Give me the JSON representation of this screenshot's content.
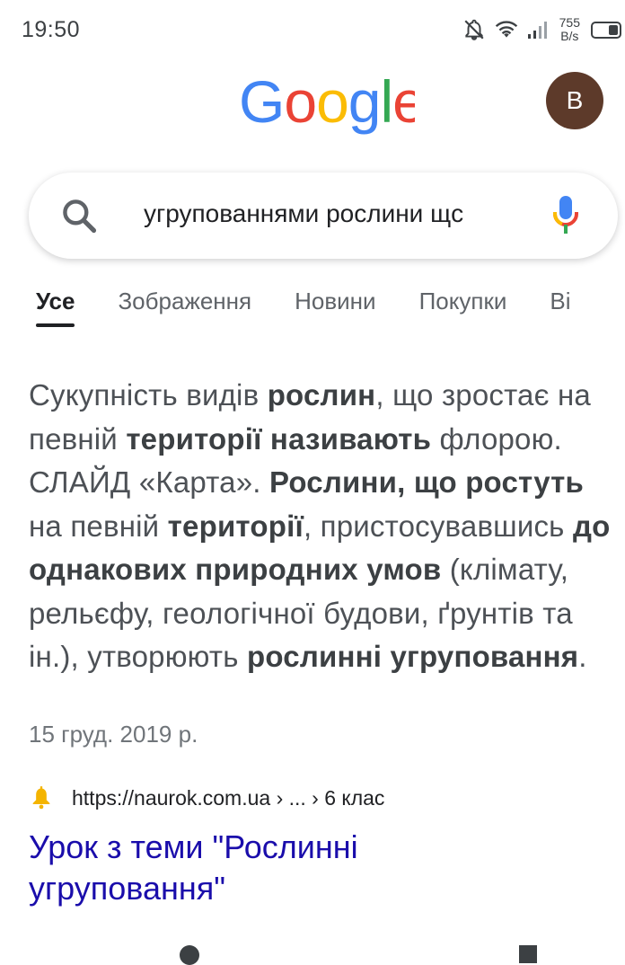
{
  "status_bar": {
    "time": "19:50",
    "net_speed_value": "755",
    "net_speed_unit": "B/s",
    "icons": [
      "bell-off-icon",
      "wifi-icon",
      "signal-icon",
      "battery-icon"
    ]
  },
  "header": {
    "logo_text": "Google",
    "avatar_letter": "B",
    "avatar_color": "#5d3a2a"
  },
  "search": {
    "query": "угрупованнями рослини щс",
    "icons": [
      "search-icon",
      "mic-icon"
    ]
  },
  "tabs": [
    {
      "label": "Усе",
      "active": true
    },
    {
      "label": "Зображення",
      "active": false
    },
    {
      "label": "Новини",
      "active": false
    },
    {
      "label": "Покупки",
      "active": false
    },
    {
      "label": "Ві",
      "active": false
    }
  ],
  "featured_snippet": {
    "segments": [
      {
        "text": "Сукупність видів ",
        "bold": false
      },
      {
        "text": "рослин",
        "bold": true
      },
      {
        "text": ", що зростає на певній ",
        "bold": false
      },
      {
        "text": "території називають",
        "bold": true
      },
      {
        "text": " флорою. СЛАЙД «Карта». ",
        "bold": false
      },
      {
        "text": "Рослини, що ростуть",
        "bold": true
      },
      {
        "text": " на певній ",
        "bold": false
      },
      {
        "text": "території",
        "bold": true
      },
      {
        "text": ", пристосувавшись ",
        "bold": false
      },
      {
        "text": "до однакових природних умов",
        "bold": true
      },
      {
        "text": " (клімату, рельєфу, геологічної будови, ґрунтів та ін.), утворюють ",
        "bold": false
      },
      {
        "text": "рослинні угруповання",
        "bold": true
      },
      {
        "text": ".",
        "bold": false
      }
    ],
    "date": "15 груд. 2019 р."
  },
  "result": {
    "url": "https://naurok.com.ua › ... › 6 клас",
    "title": "Урок з теми \"Рослинні угруповання\"",
    "favicon": "bell-favicon-icon"
  },
  "colors": {
    "link": "#1a0dab",
    "google_blue": "#4285F4",
    "google_red": "#EA4335",
    "google_yellow": "#FBBC05",
    "google_green": "#34A853"
  }
}
